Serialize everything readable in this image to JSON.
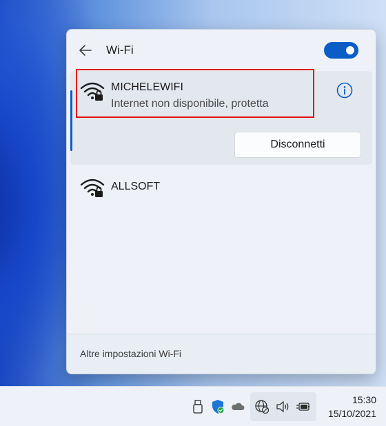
{
  "flyout": {
    "title": "Wi-Fi",
    "wifi_enabled": true,
    "accent_color": "#0a5cc7",
    "networks": [
      {
        "name": "MICHELEWIFI",
        "status": "Internet non disponibile, protetta",
        "connected": true,
        "secured": true,
        "action_label": "Disconnetti"
      },
      {
        "name": "ALLSOFT",
        "status": "",
        "connected": false,
        "secured": true
      }
    ],
    "footer_link": "Altre impostazioni Wi-Fi"
  },
  "taskbar": {
    "time": "15:30",
    "date": "15/10/2021",
    "tray_icons": [
      "usb-icon",
      "security-shield-icon",
      "onedrive-cloud-icon",
      "network-globe-icon",
      "volume-icon",
      "battery-plug-icon"
    ]
  }
}
